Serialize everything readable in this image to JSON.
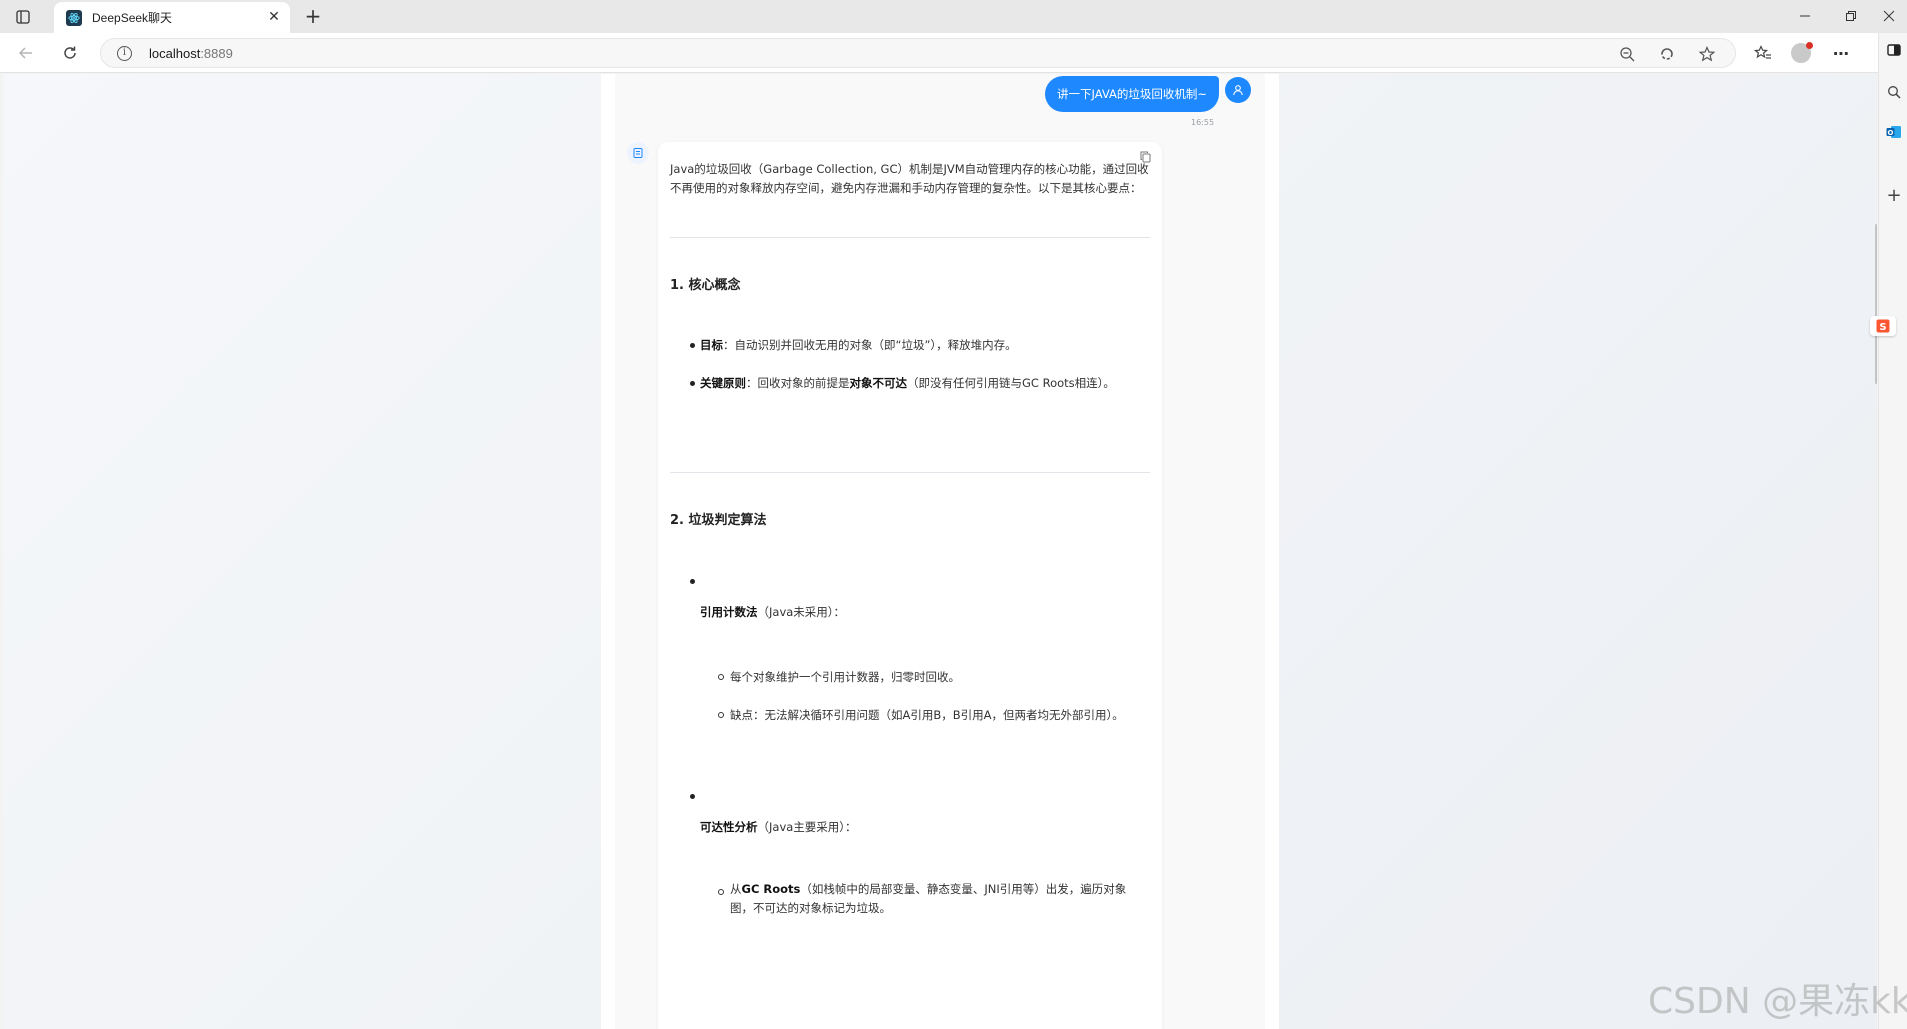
{
  "browser": {
    "tab_title": "DeepSeek聊天",
    "url_host": "localhost",
    "url_port": ":8889"
  },
  "chat": {
    "user_message": "讲一下JAVA的垃圾回收机制~",
    "user_time": "16:55",
    "answer": {
      "intro": "Java的垃圾回收（Garbage Collection, GC）机制是JVM自动管理内存的核心功能，通过回收不再使用的对象释放内存空间，避免内存泄漏和手动内存管理的复杂性。以下是其核心要点：",
      "section1_title": "1. 核心概念",
      "s1_item1_label": "目标",
      "s1_item1_text": "：自动识别并回收无用的对象（即“垃圾”），释放堆内存。",
      "s1_item2_label": "关键原则",
      "s1_item2_text_a": "：回收对象的前提是",
      "s1_item2_bold": "对象不可达",
      "s1_item2_text_b": "（即没有任何引用链与GC Roots相连）。",
      "section2_title": "2. 垃圾判定算法",
      "s2_item1_label": "引用计数法",
      "s2_item1_note": "（Java未采用）：",
      "s2_item1_sub1": "每个对象维护一个引用计数器，归零时回收。",
      "s2_item1_sub2": "缺点：无法解决循环引用问题（如A引用B，B引用A，但两者均无外部引用）。",
      "s2_item2_label": "可达性分析",
      "s2_item2_note": "（Java主要采用）：",
      "s2_item2_sub1_a": "从",
      "s2_item2_sub1_bold": "GC Roots",
      "s2_item2_sub1_b": "（如栈帧中的局部变量、静态变量、JNI引用等）出发，遍历对象图，不可达的对象标记为垃圾。"
    }
  },
  "watermark": "CSDN @果冻kk",
  "colors": {
    "accent": "#1e88ff",
    "csdn": "#fc5531"
  }
}
